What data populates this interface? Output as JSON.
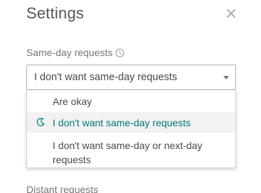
{
  "dialog": {
    "title": "Settings",
    "close_icon": "close-icon"
  },
  "same_day": {
    "label": "Same-day requests",
    "info_icon": "info-clock-icon",
    "selected_value": "I don't want same-day requests",
    "options": [
      {
        "label": "Are okay",
        "selected": false
      },
      {
        "label": "I don't want same-day requests",
        "selected": true,
        "icon": "moon-icon"
      },
      {
        "label": "I don't want same-day or next-day requests",
        "selected": false
      }
    ]
  },
  "distant": {
    "label": "Distant requests"
  },
  "colors": {
    "accent": "#00787a",
    "selected_bg": "#f2f2f2"
  }
}
